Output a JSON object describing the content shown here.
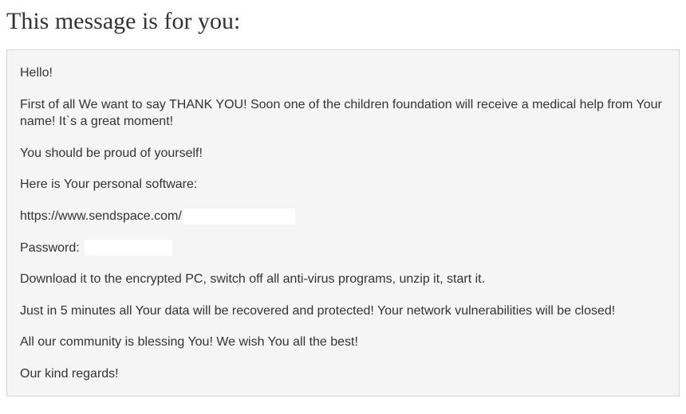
{
  "heading": "This message is for you:",
  "message": {
    "p1": "Hello!",
    "p2": "First of all We want to say THANK YOU! Soon one of the children foundation will receive a medical help from Your name! It`s a great moment!",
    "p3": "You should be proud of yourself!",
    "p4": "Here is Your personal software:",
    "url_prefix": "https://www.sendspace.com/",
    "password_label": "Password:",
    "p5": "Download it to the encrypted PC, switch off all anti-virus programs, unzip it, start it.",
    "p6": "Just in 5 minutes all Your data will be recovered and protected! Your network vulnerabilities will be closed!",
    "p7": "All our community is blessing You! We wish You all the best!",
    "p8": "Our kind regards!"
  }
}
